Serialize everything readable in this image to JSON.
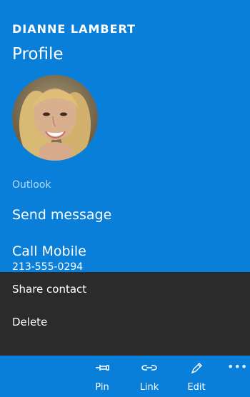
{
  "contact": {
    "name": "DIANNE LAMBERT",
    "page_title": "Profile",
    "source_label": "Outlook"
  },
  "actions": {
    "send_message": "Send message",
    "call_mobile": "Call Mobile",
    "mobile_number": "213-555-0294"
  },
  "menu": {
    "items": [
      {
        "label": "Share contact"
      },
      {
        "label": "Delete"
      }
    ]
  },
  "app_bar": {
    "buttons": [
      {
        "label": "Pin",
        "icon": "pin-icon"
      },
      {
        "label": "Link",
        "icon": "link-icon"
      },
      {
        "label": "Edit",
        "icon": "pencil-icon"
      }
    ],
    "more_icon": "more-icon"
  },
  "colors": {
    "accent": "#0a7fd9",
    "menu_background": "#2b2b2b",
    "secondary_text": "#b8dbf6"
  }
}
